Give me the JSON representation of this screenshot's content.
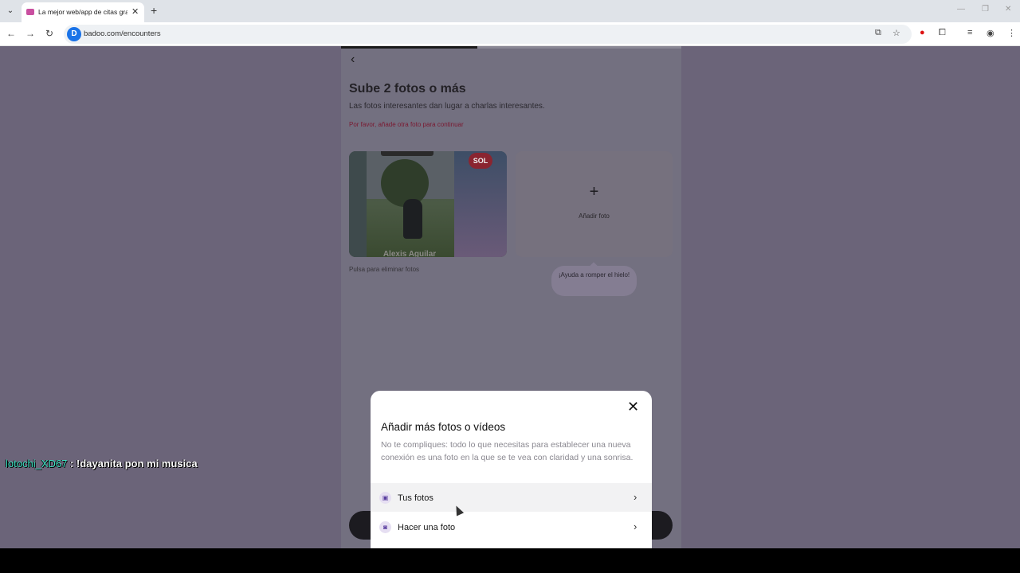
{
  "browser": {
    "tab_title": "La mejor web/app de citas grat",
    "url": "badoo.com/encounters",
    "site_badge": "D"
  },
  "page": {
    "title": "Sube 2 fotos o más",
    "subtitle": "Las fotos interesantes dan lugar a charlas interesantes.",
    "error": "Por favor, añade otra foto para continuar",
    "photo_badge": "SOL",
    "photo_name": "Alexis Aguilar",
    "add_photo_label": "Añadir foto",
    "hint": "Pulsa para eliminar fotos",
    "bubble": "¡Ayuda a romper el hielo!",
    "progress": 0.4
  },
  "sheet": {
    "title": "Añadir más fotos o vídeos",
    "description": "No te compliques: todo lo que necesitas para establecer una nueva conexión es una foto en la que se te vea con claridad y una sonrisa.",
    "options": [
      {
        "label": "Tus fotos",
        "icon": "gallery-icon"
      },
      {
        "label": "Hacer una foto",
        "icon": "camera-icon"
      }
    ]
  },
  "chat": {
    "user": "lotochi_XD67",
    "message": ": !dayanita pon mi musica"
  },
  "colors": {
    "overlay": "#6b6479",
    "accent_error": "#7a1830",
    "chat_user": "#3fe3c5"
  }
}
